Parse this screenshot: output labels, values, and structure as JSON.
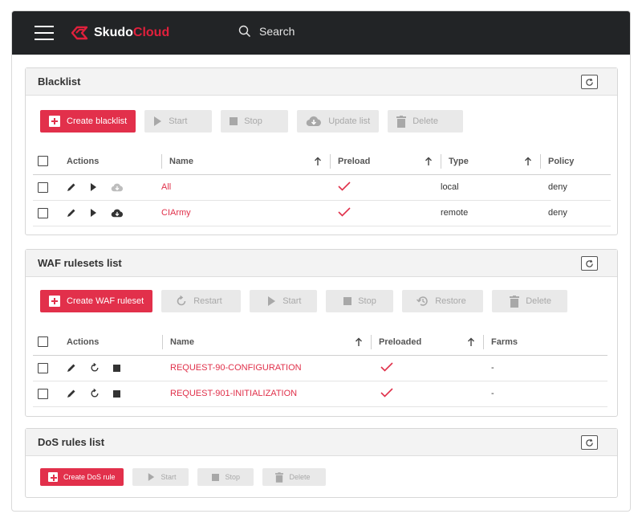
{
  "app": {
    "logo_primary": "Skudo",
    "logo_secondary": "Cloud",
    "search_label": "Search",
    "colors": {
      "accent": "#e2304b",
      "topbar": "#222426"
    }
  },
  "blacklist": {
    "title": "Blacklist",
    "buttons": {
      "create": "Create blacklist",
      "start": "Start",
      "stop": "Stop",
      "update": "Update list",
      "delete": "Delete"
    },
    "columns": [
      "Actions",
      "Name",
      "Preload",
      "Type",
      "Policy"
    ],
    "rows": [
      {
        "name": "All",
        "preload": "✓",
        "type": "local",
        "policy": "deny"
      },
      {
        "name": "CIArmy",
        "preload": "✓",
        "type": "remote",
        "policy": "deny"
      }
    ]
  },
  "waf": {
    "title": "WAF rulesets list",
    "buttons": {
      "create": "Create WAF ruleset",
      "restart": "Restart",
      "start": "Start",
      "stop": "Stop",
      "restore": "Restore",
      "delete": "Delete"
    },
    "columns": [
      "Actions",
      "Name",
      "Preloaded",
      "Farms"
    ],
    "rows": [
      {
        "name": "REQUEST-90-CONFIGURATION",
        "preloaded": "✓",
        "farms": "-"
      },
      {
        "name": "REQUEST-901-INITIALIZATION",
        "preloaded": "✓",
        "farms": "-"
      }
    ]
  },
  "dos": {
    "title": "DoS rules list",
    "buttons": {
      "create": "Create DoS rule",
      "start": "Start",
      "stop": "Stop",
      "delete": "Delete"
    }
  }
}
